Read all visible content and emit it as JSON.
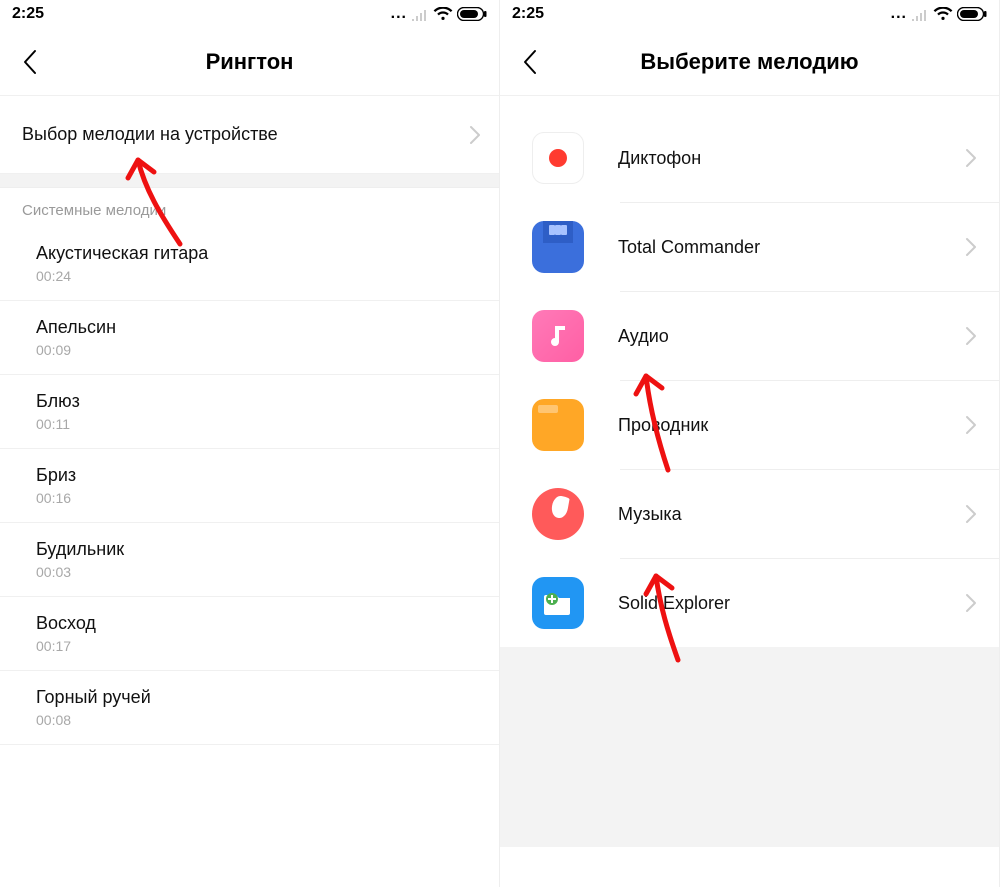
{
  "status": {
    "time": "2:25",
    "dots": "..."
  },
  "left": {
    "title": "Рингтон",
    "device_option": "Выбор мелодии на устройстве",
    "section_label": "Системные мелодии",
    "items": [
      {
        "name": "Акустическая гитара",
        "dur": "00:24"
      },
      {
        "name": "Апельсин",
        "dur": "00:09"
      },
      {
        "name": "Блюз",
        "dur": "00:11"
      },
      {
        "name": "Бриз",
        "dur": "00:16"
      },
      {
        "name": "Будильник",
        "dur": "00:03"
      },
      {
        "name": "Восход",
        "dur": "00:17"
      },
      {
        "name": "Горный ручей",
        "dur": "00:08"
      }
    ]
  },
  "right": {
    "title": "Выберите мелодию",
    "apps": [
      {
        "label": "Диктофон"
      },
      {
        "label": "Total Commander"
      },
      {
        "label": "Аудио"
      },
      {
        "label": "Проводник"
      },
      {
        "label": "Музыка"
      },
      {
        "label": "Solid Explorer"
      }
    ]
  }
}
